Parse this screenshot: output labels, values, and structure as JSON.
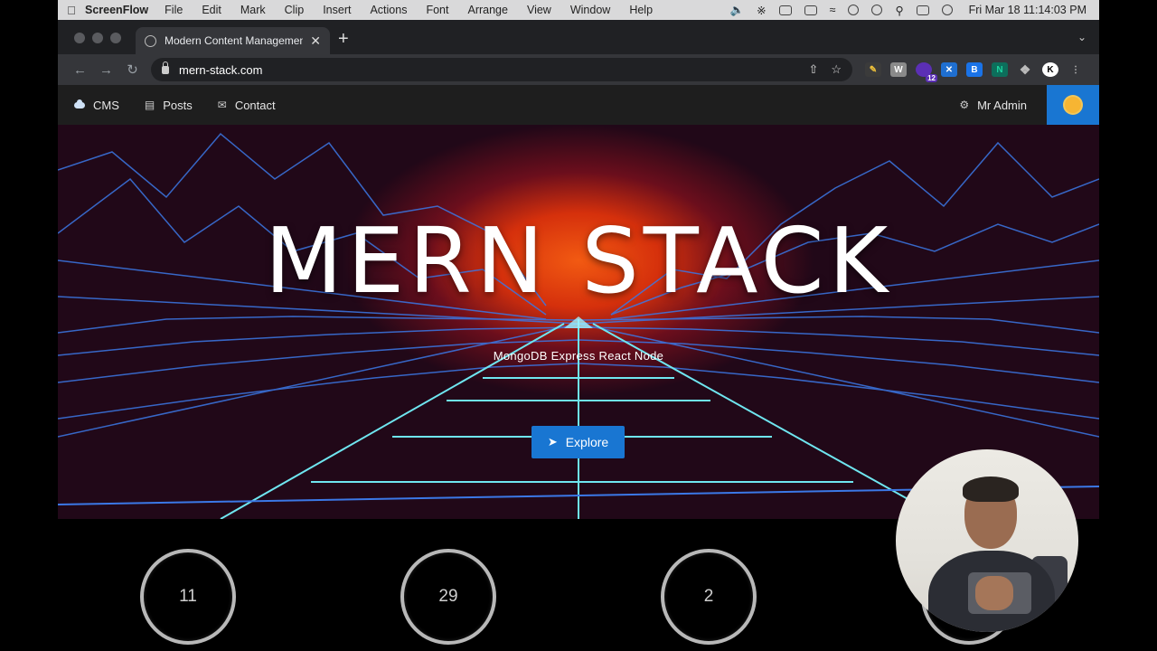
{
  "menubar": {
    "app_name": "ScreenFlow",
    "items": [
      "File",
      "Edit",
      "Mark",
      "Clip",
      "Insert",
      "Actions",
      "Font",
      "Arrange",
      "View",
      "Window",
      "Help"
    ],
    "clock": "Fri Mar 18  11:14:03 PM"
  },
  "browser": {
    "tab_title": "Modern Content Management",
    "url": "mern-stack.com",
    "extension_badge": "12",
    "extension_w": "W",
    "extension_b": "B",
    "extension_n": "N",
    "extension_k": "K"
  },
  "nav": {
    "brand": "CMS",
    "posts": "Posts",
    "contact": "Contact",
    "user": "Mr Admin"
  },
  "hero": {
    "title": "MERN STACK",
    "subtitle": "MongoDB Express React Node",
    "cta": "Explore"
  },
  "stats": [
    "11",
    "29",
    "2"
  ],
  "colors": {
    "accent": "#1976d2",
    "grid_line": "#3f8cff",
    "sun": "#f25a12"
  }
}
